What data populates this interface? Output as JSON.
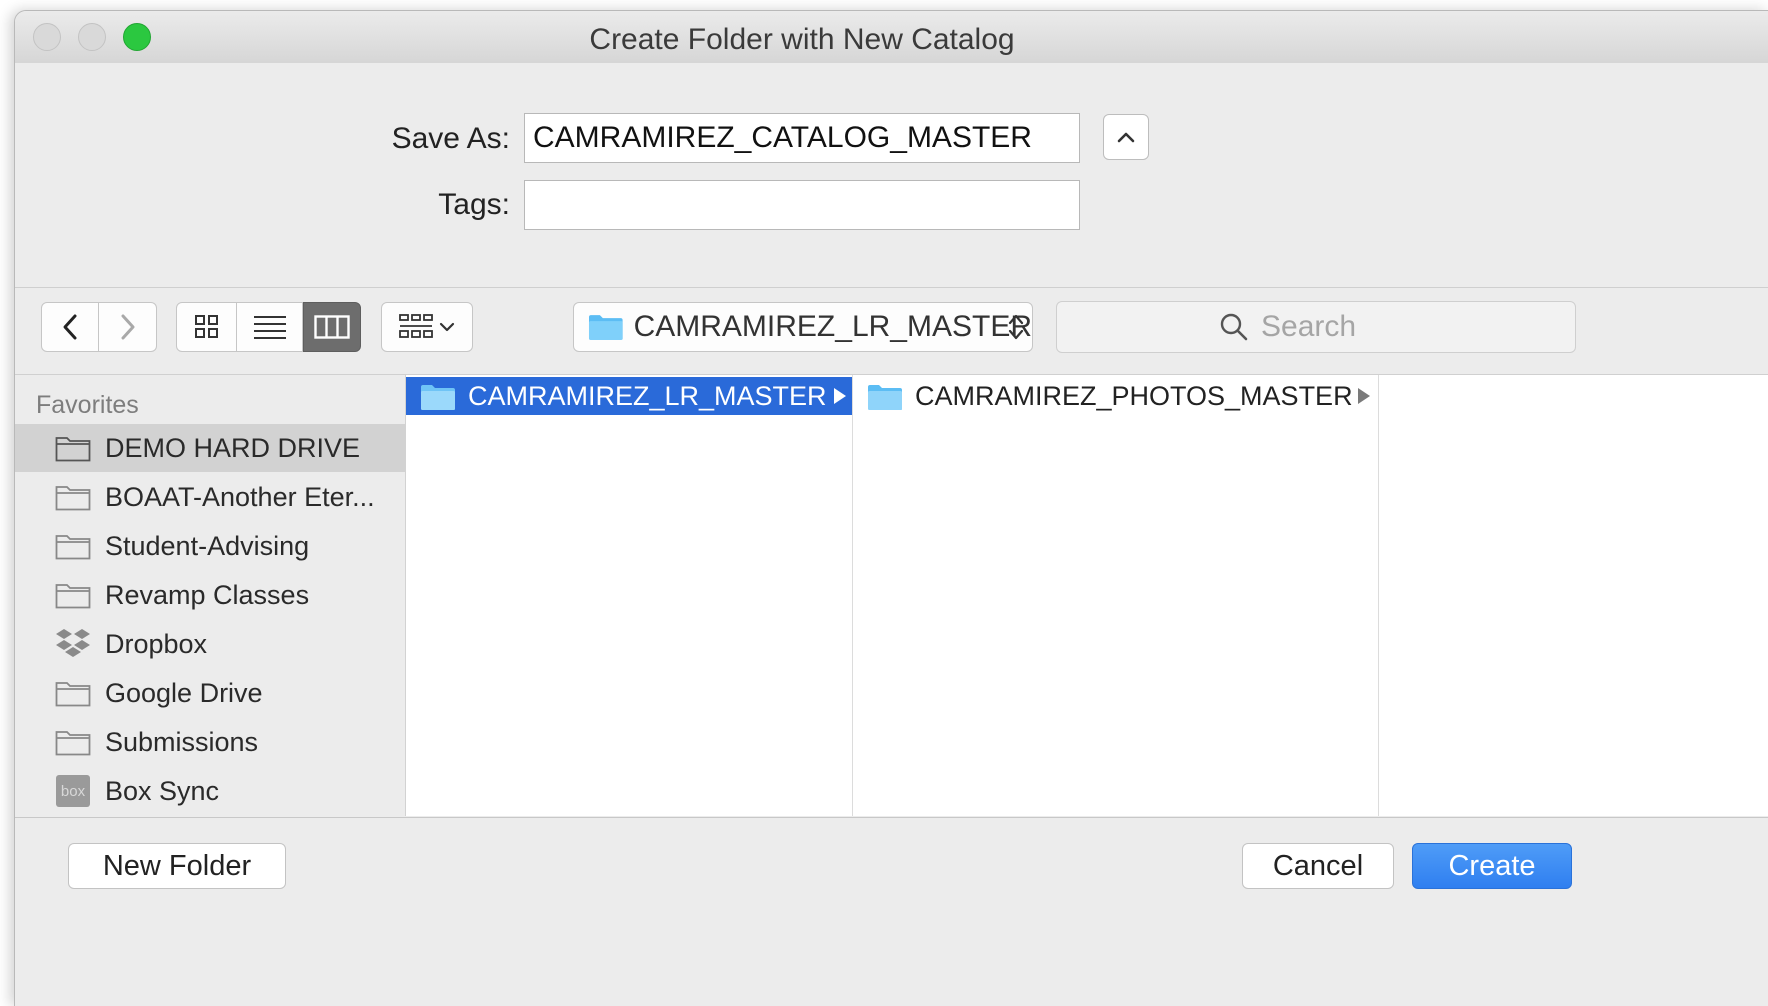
{
  "window": {
    "title": "Create Folder with New Catalog"
  },
  "form": {
    "save_as_label": "Save As:",
    "save_as_value": "CAMRAMIREZ_CATALOG_MASTER",
    "tags_label": "Tags:",
    "tags_value": ""
  },
  "toolbar": {
    "path_name": "CAMRAMIREZ_LR_MASTER",
    "search_placeholder": "Search"
  },
  "sidebar": {
    "header": "Favorites",
    "items": [
      {
        "label": "DEMO HARD DRIVE",
        "icon": "folder-icon",
        "selected": true
      },
      {
        "label": "BOAAT-Another Eter...",
        "icon": "folder-icon"
      },
      {
        "label": "Student-Advising",
        "icon": "folder-icon"
      },
      {
        "label": "Revamp Classes",
        "icon": "folder-icon"
      },
      {
        "label": "Dropbox",
        "icon": "dropbox-icon"
      },
      {
        "label": "Google Drive",
        "icon": "folder-icon"
      },
      {
        "label": "Submissions",
        "icon": "folder-icon"
      },
      {
        "label": "Box Sync",
        "icon": "box-icon",
        "badge": "box"
      }
    ]
  },
  "columns": [
    {
      "items": [
        {
          "label": "CAMRAMIREZ_LR_MASTER",
          "selected": true
        }
      ]
    },
    {
      "items": [
        {
          "label": "CAMRAMIREZ_PHOTOS_MASTER",
          "selected": false
        }
      ]
    }
  ],
  "footer": {
    "new_folder_label": "New Folder",
    "cancel_label": "Cancel",
    "create_label": "Create"
  },
  "colors": {
    "accent": "#2a6ad9",
    "primary_button": "#3a87f3",
    "folder_blue": "#5cbdf4"
  }
}
